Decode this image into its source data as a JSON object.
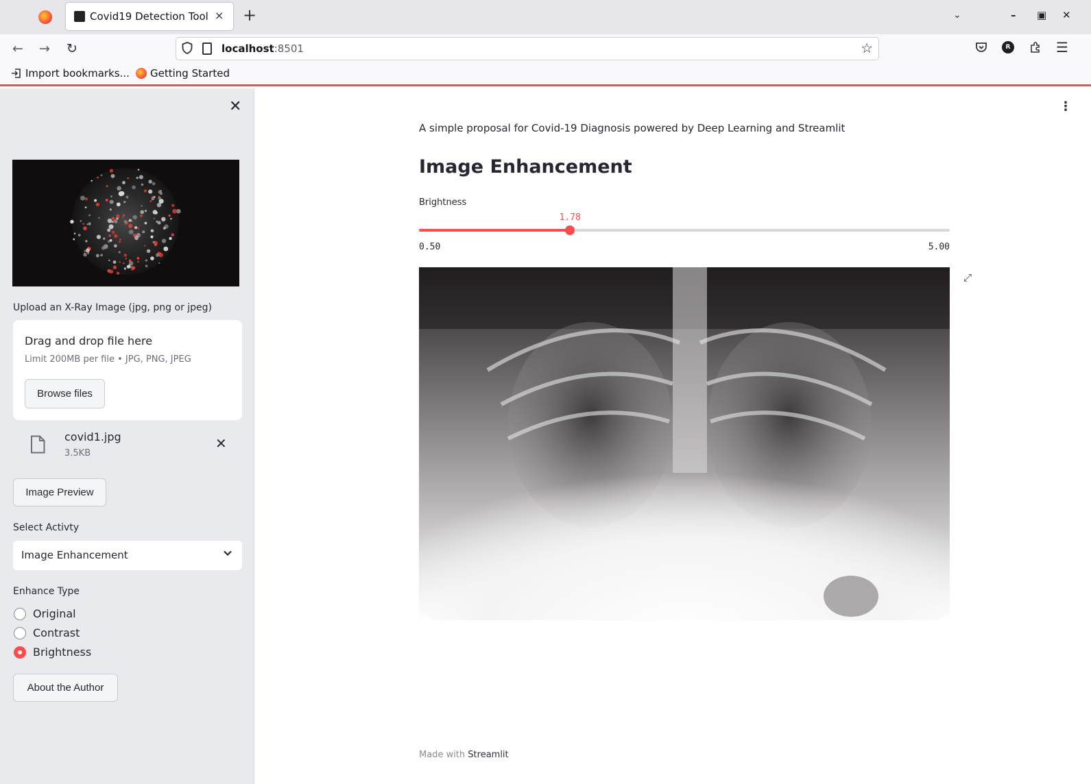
{
  "browser": {
    "tab_title": "Covid19 Detection Tool",
    "tab_close": "×",
    "new_tab": "+",
    "url_host": "localhost",
    "url_port": ":8501",
    "bookmarks": [
      "Import bookmarks...",
      "Getting Started"
    ],
    "icons": [
      "firefox-icon",
      "back-icon",
      "forward-icon",
      "reload-icon",
      "shield-icon",
      "page-icon",
      "bookmark-star-icon",
      "pocket-icon",
      "account-icon",
      "extensions-icon",
      "menu-icon"
    ]
  },
  "sidebar": {
    "close": "✕",
    "upload_label": "Upload an X-Ray Image (jpg, png or jpeg)",
    "uploader": {
      "title": "Drag and drop file here",
      "limit": "Limit 200MB per file • JPG, PNG, JPEG",
      "browse_button": "Browse files"
    },
    "file": {
      "name": "covid1.jpg",
      "size": "3.5KB",
      "remove": "✕"
    },
    "preview_button": "Image Preview",
    "activity_label": "Select Activty",
    "activity_value": "Image Enhancement",
    "enhance_label": "Enhance Type",
    "enhance_options": [
      "Original",
      "Contrast",
      "Brightness"
    ],
    "enhance_selected": "Brightness",
    "author_button": "About the Author"
  },
  "main": {
    "subtitle": "A simple proposal for Covid-19 Diagnosis powered by Deep Learning and Streamlit",
    "heading": "Image Enhancement",
    "slider": {
      "label": "Brightness",
      "value": "1.78",
      "min": "0.50",
      "max": "5.00",
      "value_num": 1.78,
      "min_num": 0.5,
      "max_num": 5.0
    },
    "footer_prefix": "Made with ",
    "footer_brand": "Streamlit"
  },
  "colors": {
    "accent": "#ff4b4b",
    "sidebar_bg": "#e8eaed",
    "text": "#262730"
  }
}
